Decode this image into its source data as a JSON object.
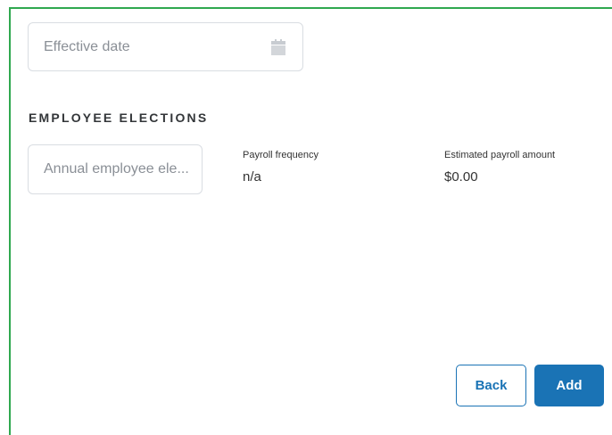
{
  "form": {
    "effective_date": {
      "value": "",
      "placeholder": "Effective date",
      "icon": "calendar-icon"
    },
    "section_title": "EMPLOYEE ELECTIONS",
    "annual_election": {
      "value": "",
      "placeholder": "Annual employee ele..."
    },
    "payroll_frequency": {
      "label": "Payroll frequency",
      "value": "n/a"
    },
    "estimated_payroll_amount": {
      "label": "Estimated payroll amount",
      "value": "$0.00"
    }
  },
  "actions": {
    "back_label": "Back",
    "add_label": "Add"
  },
  "colors": {
    "frame_border": "#2fa84f",
    "primary": "#1a73b5",
    "field_border": "#d9dde2"
  }
}
